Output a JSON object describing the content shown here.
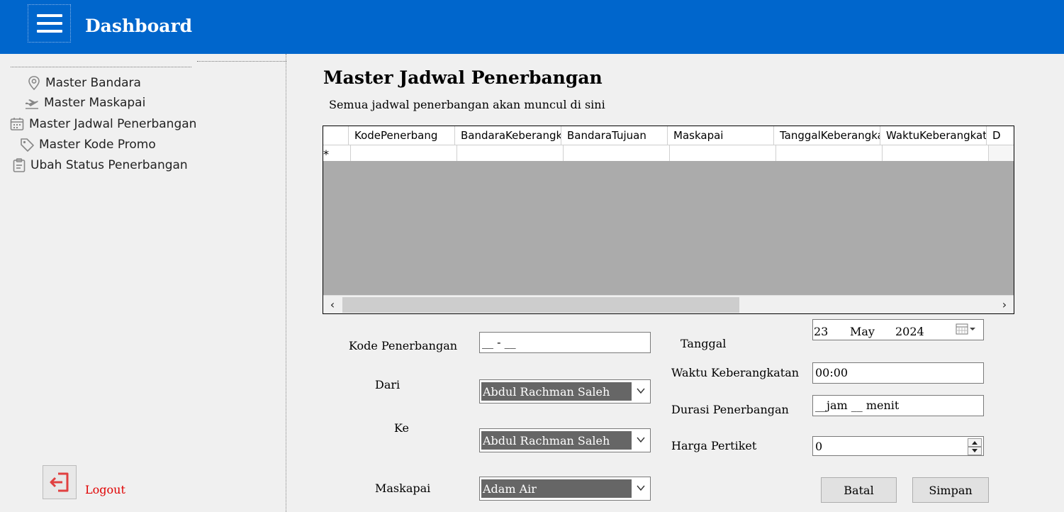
{
  "header": {
    "title": "Dashboard"
  },
  "sidebar": {
    "items": [
      {
        "label": "Master Bandara",
        "icon": "map-pin-icon"
      },
      {
        "label": "Master Maskapai",
        "icon": "plane-departure-icon"
      },
      {
        "label": "Master Jadwal Penerbangan",
        "icon": "calendar-icon"
      },
      {
        "label": "Master Kode Promo",
        "icon": "tag-icon"
      },
      {
        "label": "Ubah Status Penerbangan",
        "icon": "clipboard-icon"
      }
    ],
    "logout_label": "Logout"
  },
  "main": {
    "title": "Master Jadwal Penerbangan",
    "subtitle": "Semua jadwal penerbangan akan muncul di sini",
    "grid": {
      "columns": [
        "KodePenerbang",
        "BandaraKeberangkatan",
        "BandaraTujuan",
        "Maskapai",
        "TanggalKeberangkatan",
        "WaktuKeberangkatan",
        "D"
      ],
      "new_row_marker": "*"
    },
    "form": {
      "kode_label": "Kode Penerbangan",
      "kode_value": "__ - __",
      "dari_label": "Dari",
      "dari_value": "Abdul Rachman Saleh",
      "ke_label": "Ke",
      "ke_value": "Abdul Rachman Saleh",
      "maskapai_label": "Maskapai",
      "maskapai_value": "Adam Air",
      "tanggal_label": "Tanggal",
      "tanggal_day": "23",
      "tanggal_month": "May",
      "tanggal_year": "2024",
      "waktu_label": "Waktu Keberangkatan",
      "waktu_value": "00:00",
      "durasi_label": "Durasi Penerbangan",
      "durasi_value": "__jam __ menit",
      "harga_label": "Harga Pertiket",
      "harga_value": "0",
      "batal_label": "Batal",
      "simpan_label": "Simpan"
    }
  },
  "colors": {
    "header_bg": "#0066cc",
    "logout_red": "#e00000",
    "grid_bg": "#ababab",
    "combo_selected_bg": "#666666"
  }
}
